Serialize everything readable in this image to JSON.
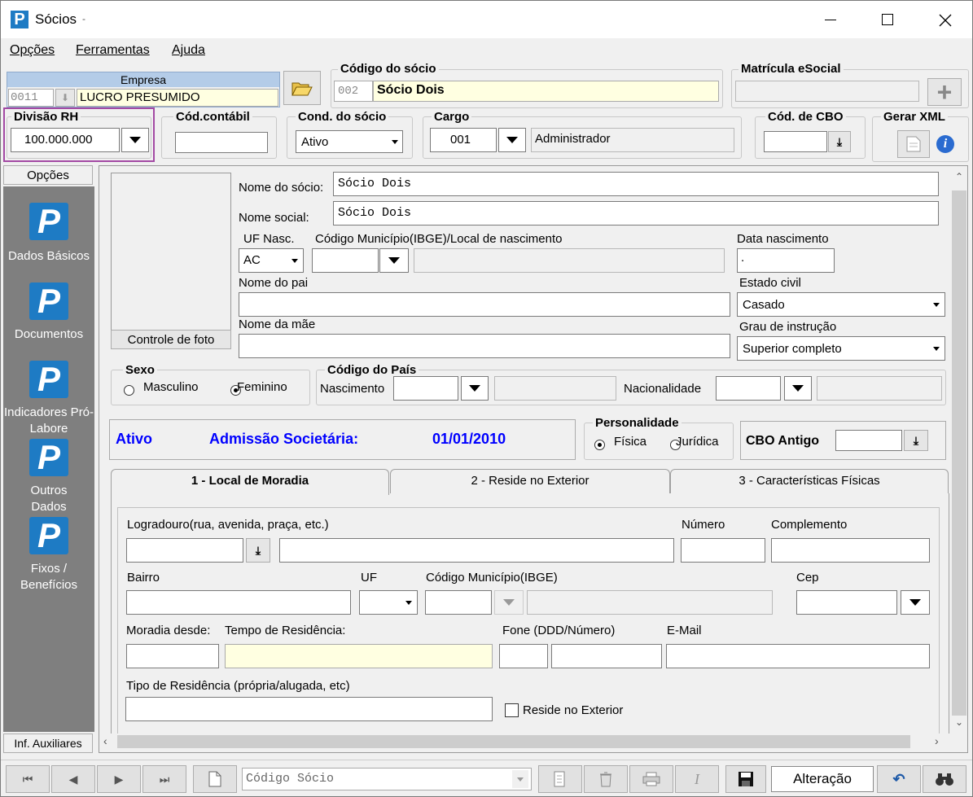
{
  "window": {
    "title": "Sócios",
    "title_suffix": "-"
  },
  "menu": {
    "opcoes": "Opções",
    "ferramentas": "Ferramentas",
    "ajuda": "Ajuda"
  },
  "empresa": {
    "label": "Empresa",
    "code": "0011",
    "name": "LUCRO PRESUMIDO"
  },
  "codigo_socio": {
    "label": "Código do sócio",
    "code": "002",
    "name": "Sócio Dois"
  },
  "matricula": {
    "label": "Matrícula eSocial",
    "value": ""
  },
  "divisao_rh": {
    "label": "Divisão RH",
    "value": "100.000.000"
  },
  "cod_contabil": {
    "label": "Cód.contábil",
    "value": ""
  },
  "cond_socio": {
    "label": "Cond. do sócio",
    "value": "Ativo"
  },
  "cargo": {
    "label": "Cargo",
    "code": "001",
    "name": "Administrador"
  },
  "cbo": {
    "label": "Cód. de CBO",
    "value": ""
  },
  "gerar_xml": {
    "label": "Gerar XML"
  },
  "sidebar": {
    "top_button": "Opções",
    "items": [
      {
        "label": "Dados Básicos"
      },
      {
        "label": "Documentos"
      },
      {
        "label": "Indicadores Pró-Labore"
      },
      {
        "label": "Outros Dados"
      },
      {
        "label": "Fixos / Benefícios"
      }
    ],
    "bottom_button": "Inf. Auxiliares"
  },
  "form": {
    "photo_button": "Controle de foto",
    "nome_socio_label": "Nome do sócio:",
    "nome_socio": "Sócio Dois",
    "nome_social_label": "Nome social:",
    "nome_social": "Sócio Dois",
    "uf_nasc_label": "UF Nasc.",
    "uf_nasc": "AC",
    "cod_mun_label": "Código Município(IBGE)/Local de nascimento",
    "data_nasc_label": "Data nascimento",
    "data_nasc": ".",
    "nome_pai_label": "Nome do pai",
    "estado_civil_label": "Estado civil",
    "estado_civil": "Casado",
    "nome_mae_label": "Nome da mãe",
    "grau_label": "Grau de instrução",
    "grau": "Superior completo",
    "sexo_label": "Sexo",
    "sexo_m": "Masculino",
    "sexo_f": "Feminino",
    "sexo_selected": "Feminino",
    "pais_label": "Código do País",
    "nascimento_label": "Nascimento",
    "nacionalidade_label": "Nacionalidade"
  },
  "status": {
    "state": "Ativo",
    "admissao_label": "Admissão Societária:",
    "admissao_date": "01/01/2010",
    "personalidade_label": "Personalidade",
    "fisica": "Física",
    "juridica": "Jurídica",
    "personalidade_selected": "Física",
    "cbo_antigo_label": "CBO Antigo"
  },
  "tabs": [
    {
      "label": "1 - Local de Moradia",
      "active": true
    },
    {
      "label": "2 - Reside no Exterior",
      "active": false
    },
    {
      "label": "3 - Características Físicas",
      "active": false
    }
  ],
  "moradia": {
    "logradouro_label": "Logradouro(rua, avenida, praça, etc.)",
    "numero_label": "Número",
    "complemento_label": "Complemento",
    "bairro_label": "Bairro",
    "uf_label": "UF",
    "cod_mun_label": "Código Município(IBGE)",
    "cep_label": "Cep",
    "moradia_desde_label": "Moradia desde:",
    "tempo_label": "Tempo de Residência:",
    "fone_label": "Fone (DDD/Número)",
    "email_label": "E-Mail",
    "tipo_label": "Tipo de Residência  (própria/alugada, etc)",
    "reside_exterior_label": "Reside no Exterior"
  },
  "bottombar": {
    "search_placeholder": "Código Sócio",
    "mode": "Alteração"
  },
  "colors": {
    "accent": "#1e7bc4",
    "highlight_border": "#a349a4",
    "status_blue": "#0000ff",
    "sidebar_bg": "#7f7f7f",
    "readonly_yellow": "#ffffe1"
  }
}
